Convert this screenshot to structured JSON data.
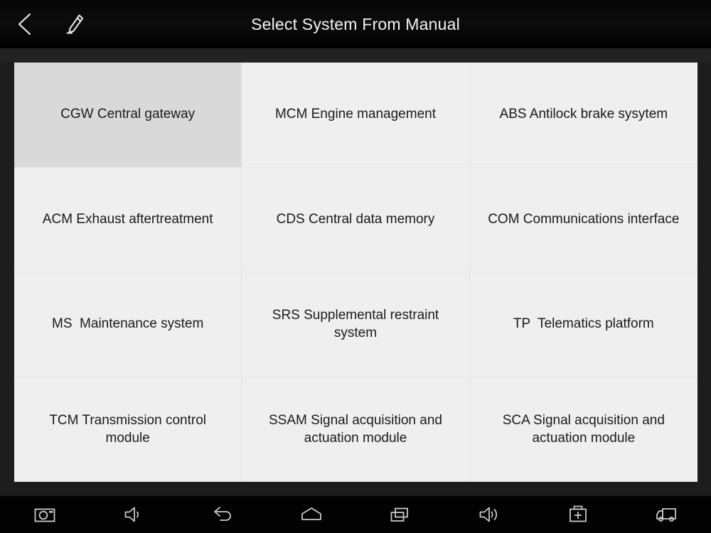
{
  "header": {
    "title": "Select System From Manual",
    "back_icon": "back-chevron-icon",
    "edit_icon": "pencil-icon"
  },
  "grid": {
    "columns": 3,
    "rows": 4,
    "selected_index": 0,
    "selected_color": "#d9d9d9",
    "cell_color": "#efefef",
    "items": [
      {
        "label": "CGW Central gateway",
        "selected": true
      },
      {
        "label": "MCM Engine management",
        "selected": false
      },
      {
        "label": "ABS Antilock brake sysytem",
        "selected": false
      },
      {
        "label": "ACM Exhaust aftertreatment",
        "selected": false
      },
      {
        "label": "CDS Central data memory",
        "selected": false
      },
      {
        "label": "COM Communications interface",
        "selected": false
      },
      {
        "label": "MS  Maintenance system",
        "selected": false
      },
      {
        "label": "SRS Supplemental restraint system",
        "selected": false
      },
      {
        "label": "TP  Telematics platform",
        "selected": false
      },
      {
        "label": "TCM Transmission control module",
        "selected": false
      },
      {
        "label": "SSAM Signal acquisition and actuation module",
        "selected": false
      },
      {
        "label": "SCA Signal acquisition and actuation module",
        "selected": false
      }
    ]
  },
  "navbar": {
    "buttons": [
      {
        "icon": "camera-screenshot-icon"
      },
      {
        "icon": "volume-down-icon"
      },
      {
        "icon": "back-arrow-icon"
      },
      {
        "icon": "home-icon"
      },
      {
        "icon": "recent-apps-icon"
      },
      {
        "icon": "volume-up-icon"
      },
      {
        "icon": "toolbox-icon"
      },
      {
        "icon": "truck-icon"
      }
    ]
  },
  "colors": {
    "page_background": "#1d1d1d",
    "header_background": "#000000",
    "navbar_background": "#020202",
    "text_primary": "#1a1a1a",
    "title_text": "#f4f4f4",
    "icon_stroke": "#cfcfcf"
  }
}
